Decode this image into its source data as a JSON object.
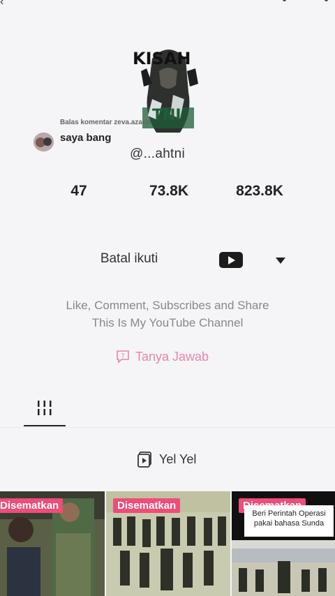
{
  "header": {
    "back_icon": "chevron-left-icon"
  },
  "comment_overlay": {
    "reply_context": "Balas komentar zeva.azaria",
    "text": "saya bang"
  },
  "profile": {
    "logo_text_top": "KISAH",
    "logo_text_bottom": "TNI",
    "username": "@...ahtni",
    "stats": {
      "following": "47",
      "followers": "73.8K",
      "likes": "823.8K"
    }
  },
  "actions": {
    "unfollow_label": "Batal ikuti",
    "youtube_icon": "youtube-icon",
    "more_icon": "caret-down-icon"
  },
  "bio": {
    "line1": "Like, Comment, Subscribes and Share",
    "line2": "This Is My YouTube Channel"
  },
  "qa": {
    "label": "Tanya Jawab",
    "icon": "question-bubble-icon"
  },
  "tabs": {
    "videos_icon": "grid-icon"
  },
  "playlist": {
    "label": "Yel Yel",
    "icon": "playlist-icon"
  },
  "videos": [
    {
      "badge": "Disematkan"
    },
    {
      "badge": "Disematkan"
    },
    {
      "badge": "Disematkan",
      "caption_line1": "Beri Perintah Operasi",
      "caption_line2": "pakai bahasa Sunda"
    }
  ],
  "colors": {
    "accent_pink": "#ee4d79",
    "qa_pink": "#e58aa6",
    "background": "#f5f4f6"
  }
}
